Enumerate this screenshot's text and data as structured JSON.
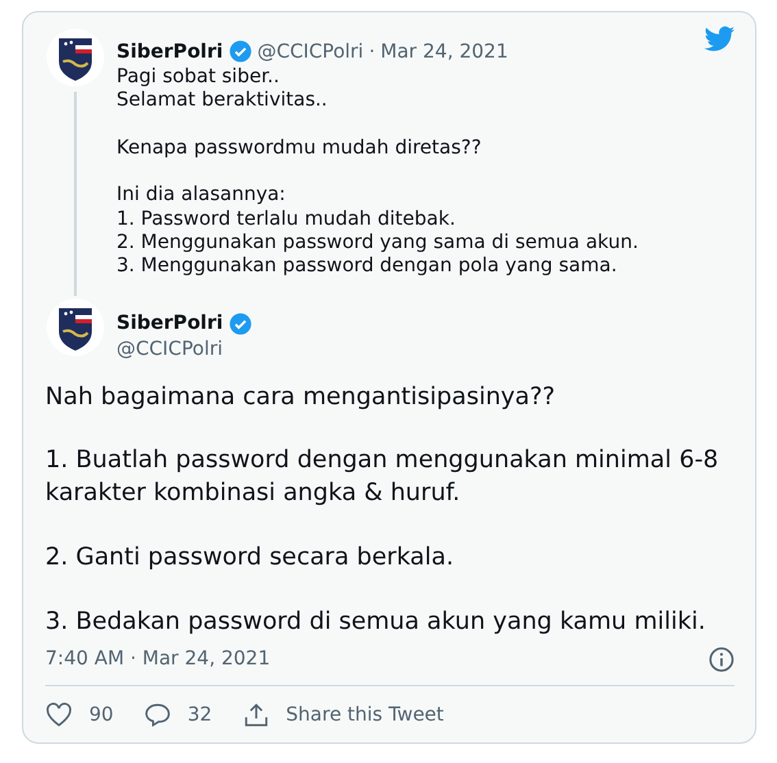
{
  "quoted_tweet": {
    "name": "SiberPolri",
    "verified": true,
    "handle": "@CCICPolri",
    "separator": "·",
    "date": "Mar 24, 2021",
    "text": "Pagi sobat siber..\nSelamat beraktivitas..\n\nKenapa passwordmu mudah diretas??\n\nIni dia alasannya:\n1. Password terlalu mudah ditebak.\n2. Menggunakan password yang sama di semua akun.\n3. Menggunakan password dengan pola yang sama."
  },
  "tweet": {
    "name": "SiberPolri",
    "verified": true,
    "handle": "@CCICPolri",
    "text": "Nah bagaimana cara mengantisipasinya??\n\n1. Buatlah password dengan menggunakan minimal 6-8 karakter kombinasi angka & huruf.\n\n2. Ganti password secara berkala.\n\n3. Bedakan password di semua akun yang kamu miliki.",
    "timestamp": "7:40 AM · Mar 24, 2021"
  },
  "actions": [
    {
      "kind": "like",
      "count": "90"
    },
    {
      "kind": "reply",
      "count": "32"
    },
    {
      "kind": "share",
      "label": "Share this Tweet"
    }
  ]
}
